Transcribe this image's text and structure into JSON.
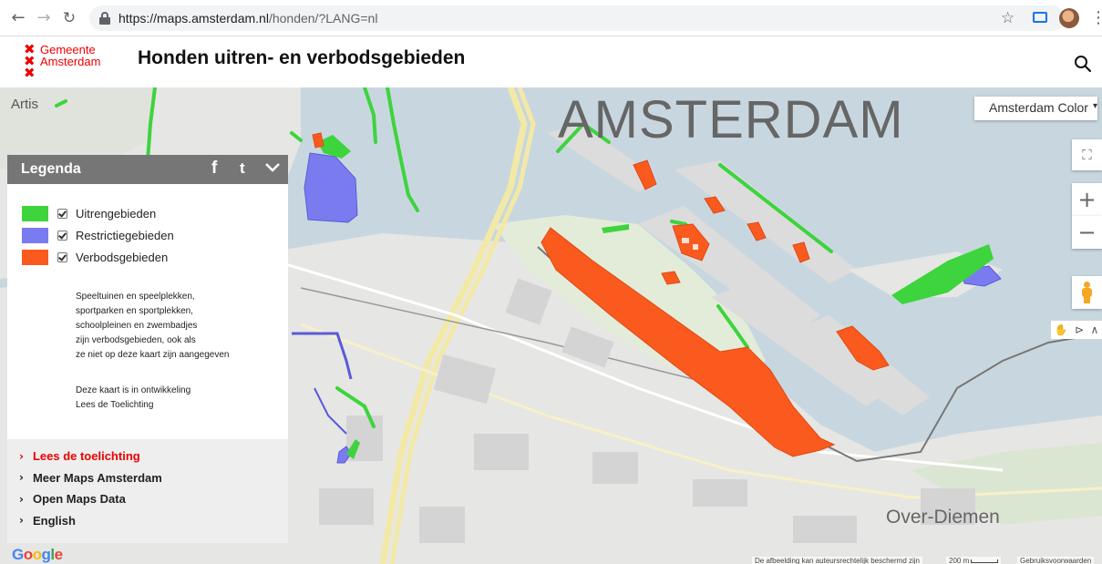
{
  "browser": {
    "url_host": "https://maps.amsterdam.nl",
    "url_path": "/honden/?LANG=nl"
  },
  "header": {
    "logo_line1": "Gemeente",
    "logo_line2": "Amsterdam",
    "title": "Honden uitren- en verbodsgebieden"
  },
  "map": {
    "city_label": "AMSTERDAM",
    "label_artis": "Artis",
    "label_over_diemen": "Over-Diemen",
    "layer_select": "Amsterdam Color",
    "google": "Google",
    "attribution": "De afbeelding kan auteursrechtelijk beschermd zijn",
    "scale": "200 m",
    "terms": "Gebruiksvoorwaarden",
    "colors": {
      "uitren": "#3dd43d",
      "restrictie": "#7b7bf0",
      "verbod": "#fa5a1e",
      "water": "#c8d7df",
      "land": "#e6e6e4"
    }
  },
  "legend": {
    "title": "Legenda",
    "facebook": "f",
    "twitter": "t",
    "items": [
      {
        "label": "Uitrengebieden",
        "color": "#3dd43d",
        "checked": true
      },
      {
        "label": "Restrictiegebieden",
        "color": "#7b7bf0",
        "checked": true
      },
      {
        "label": "Verbodsgebieden",
        "color": "#fa5a1e",
        "checked": true
      }
    ],
    "note_lines": [
      "Speeltuinen en speelplekken,",
      "sportparken en sportplekken,",
      "schoolpleinen en zwembadjes",
      "zijn verbodsgebieden, ook als",
      "ze niet op deze kaart zijn aangegeven"
    ],
    "dev_lines": [
      "Deze kaart is in ontwikkeling",
      "Lees de Toelichting"
    ],
    "links": [
      "Lees de toelichting",
      "Meer Maps Amsterdam",
      "Open Maps Data",
      "English"
    ]
  }
}
